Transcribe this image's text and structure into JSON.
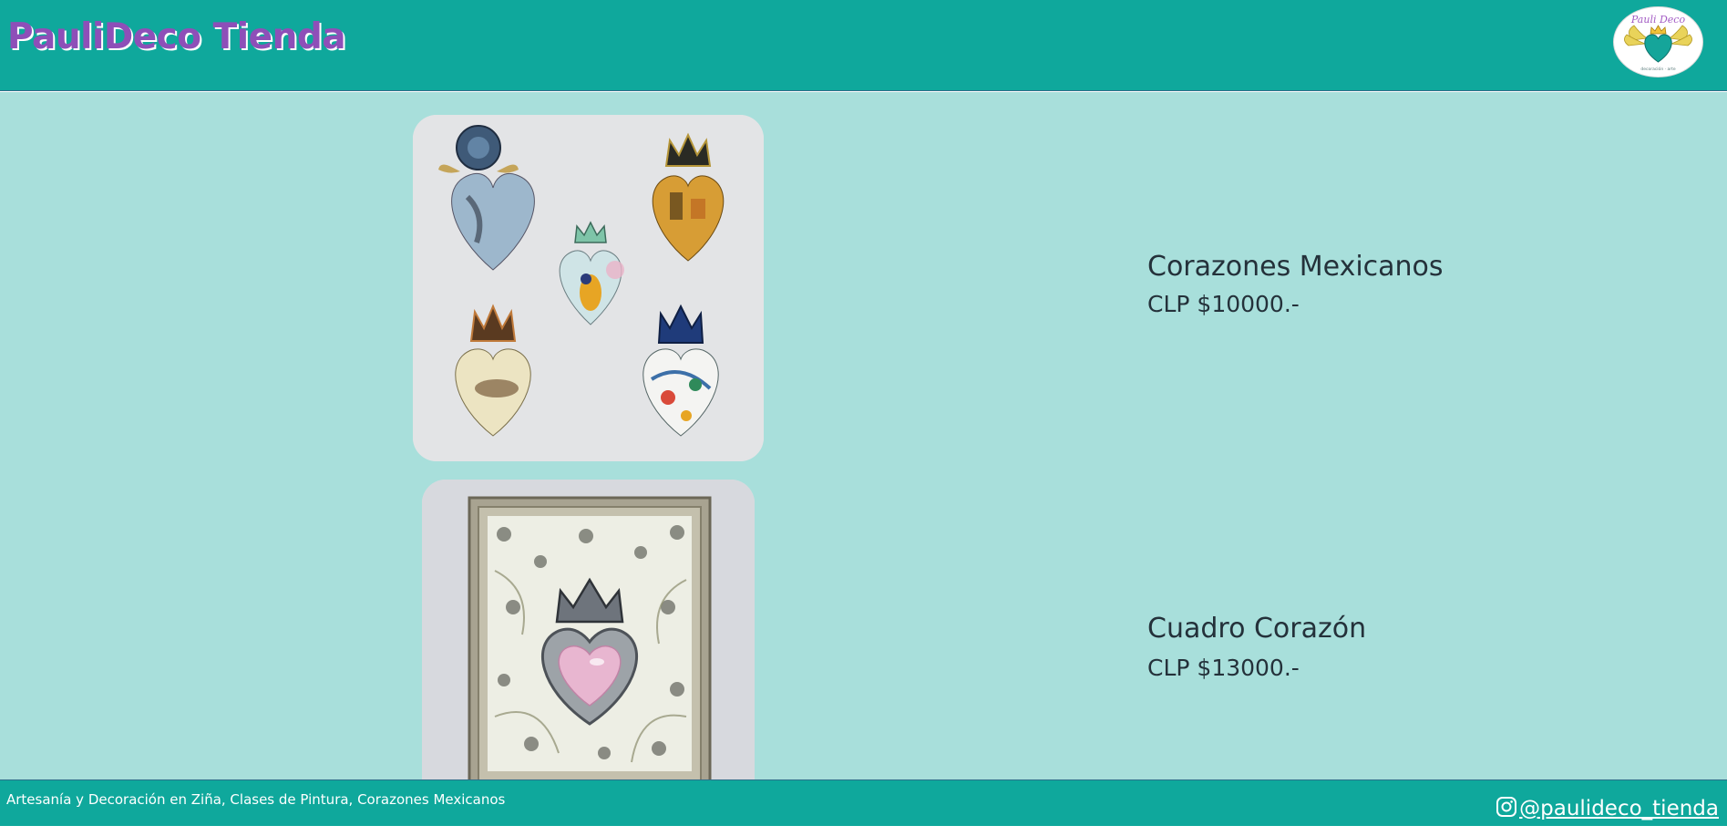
{
  "header": {
    "brand": "PauliDeco Tienda",
    "logo_icon": "pauli-deco-winged-heart-logo"
  },
  "products": [
    {
      "name": "Corazones Mexicanos",
      "price": "CLP $10000.-",
      "image_icon": "mexican-hearts-photo"
    },
    {
      "name": "Cuadro Corazón",
      "price": "CLP $13000.-",
      "image_icon": "framed-heart-photo"
    }
  ],
  "footer": {
    "tagline": "Artesanía y Decoración en Ziña, Clases de Pintura, Corazones Mexicanos",
    "instagram_handle": "@paulideco_tienda",
    "instagram_icon": "instagram-icon"
  },
  "colors": {
    "header_bg": "#0fa89c",
    "main_bg": "#a8dfdb",
    "brand_text": "#8e4fb8",
    "product_text": "#24313a"
  }
}
